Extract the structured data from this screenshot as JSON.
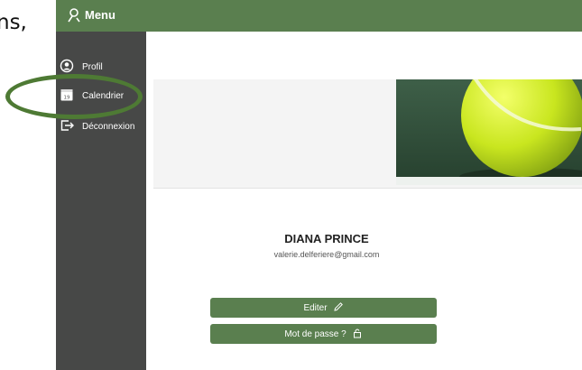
{
  "background_text": "ns,",
  "topbar": {
    "menu_label": "Menu",
    "menu_icon": "menu-icon"
  },
  "sidebar": {
    "items": [
      {
        "label": "Profil",
        "icon": "profile-icon"
      },
      {
        "label": "Calendrier",
        "icon": "calendar-icon",
        "calendar_day": "19"
      },
      {
        "label": "Déconnexion",
        "icon": "logout-icon"
      }
    ]
  },
  "profile": {
    "name": "DIANA PRINCE",
    "email": "valerie.delferiere@gmail.com"
  },
  "actions": {
    "edit_label": "Editer",
    "password_label": "Mot de passe ?"
  },
  "colors": {
    "accent": "#5a7f4f",
    "sidebar": "#474847",
    "highlight": "#4e7a34"
  }
}
